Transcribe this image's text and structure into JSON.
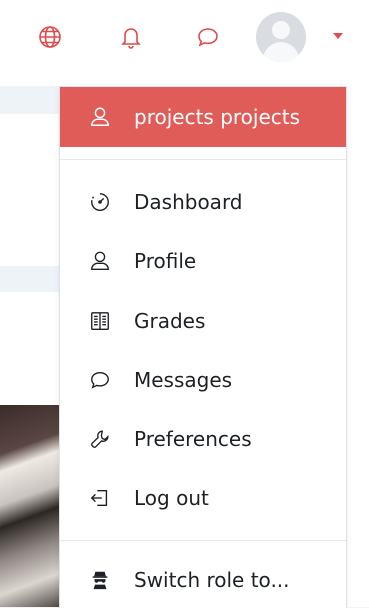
{
  "colors": {
    "accent": "#e05c58",
    "icon_red": "#e04b4b",
    "text": "#1d2125"
  },
  "navbar": {
    "language_icon": "globe-icon",
    "notifications_icon": "bell-icon",
    "messages_icon": "chat-bubble-icon",
    "avatar_icon": "user-avatar",
    "menu_toggle_icon": "caret-down-icon"
  },
  "user_menu": {
    "user_name": "projects projects",
    "items": [
      {
        "label": "Dashboard",
        "icon": "dashboard-gauge-icon"
      },
      {
        "label": "Profile",
        "icon": "user-icon"
      },
      {
        "label": "Grades",
        "icon": "grades-book-icon"
      },
      {
        "label": "Messages",
        "icon": "chat-bubble-icon"
      },
      {
        "label": "Preferences",
        "icon": "wrench-icon"
      },
      {
        "label": "Log out",
        "icon": "logout-icon"
      }
    ],
    "switch_role_label": "Switch role to...",
    "switch_role_icon": "user-secret-icon"
  }
}
